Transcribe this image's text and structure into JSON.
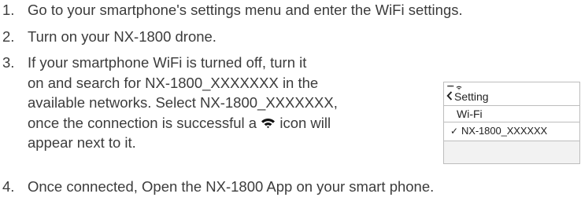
{
  "steps": [
    {
      "number": "1.",
      "lines": [
        "Go to your smartphone's settings menu and enter the WiFi settings."
      ]
    },
    {
      "number": "2.",
      "lines": [
        "Turn on your NX-1800 drone."
      ]
    },
    {
      "number": "3.",
      "lines": [
        "If your smartphone WiFi is turned off, turn it",
        "on and search for NX-1800_XXXXXXX in the",
        "available networks. Select NX-1800_XXXXXXX,",
        "once the connection is successful a",
        "icon will",
        "appear next to it."
      ]
    },
    {
      "number": "4.",
      "lines": [
        "Once connected, Open the NX-1800 App on your smart phone."
      ]
    }
  ],
  "inline_icon": "wifi-icon",
  "phone": {
    "signal_dots": "•••••",
    "status_icon": "wifi-icon",
    "back_icon": "chevron-left-icon",
    "back_label": "Setting",
    "wifi_label": "Wi-Fi",
    "check_icon": "checkmark-icon",
    "check_glyph": "✓",
    "network_name": "NX-1800_XXXXXX"
  },
  "colors": {
    "text": "#3c3c3c",
    "border": "#bdbdbd",
    "panel_gray": "#f2f2f2"
  }
}
